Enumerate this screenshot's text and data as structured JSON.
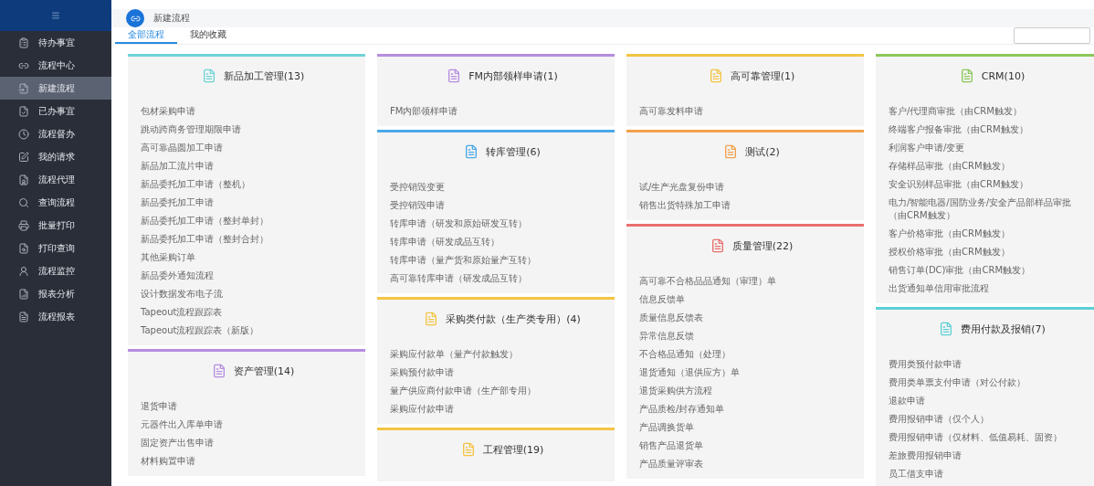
{
  "sidebar": {
    "items": [
      {
        "label": "待办事宜",
        "selected": false
      },
      {
        "label": "流程中心",
        "selected": false
      },
      {
        "label": "新建流程",
        "selected": true
      },
      {
        "label": "已办事宜",
        "selected": false
      },
      {
        "label": "流程督办",
        "selected": false
      },
      {
        "label": "我的请求",
        "selected": false
      },
      {
        "label": "流程代理",
        "selected": false
      },
      {
        "label": "查询流程",
        "selected": false
      },
      {
        "label": "批量打印",
        "selected": false
      },
      {
        "label": "打印查询",
        "selected": false
      },
      {
        "label": "流程监控",
        "selected": false
      },
      {
        "label": "报表分析",
        "selected": false
      },
      {
        "label": "流程报表",
        "selected": false
      }
    ]
  },
  "header": {
    "title": "新建流程"
  },
  "tabs": [
    {
      "label": "全部流程",
      "selected": true
    },
    {
      "label": "我的收藏",
      "selected": false
    }
  ],
  "columns": [
    [
      {
        "title": "新品加工管理(13)",
        "color": "#6fd3d6",
        "items": [
          "包材采购申请",
          "跳动跨商务管理期限申请",
          "高可靠晶圆加工申请",
          "新品加工流片申请",
          "新品委托加工申请（整机）",
          "新品委托加工申请",
          "新品委托加工申请（整封单封）",
          "新品委托加工申请（整封合封）",
          "其他采购订单",
          "新品委外通知流程",
          "设计数据发布电子流",
          "Tapeout流程跟踪表",
          "Tapeout流程跟踪表（新版）"
        ]
      },
      {
        "title": "资产管理(14)",
        "color": "#b68de0",
        "items": [
          "退货申请",
          "元器件出入库单申请",
          "固定资产出售申请",
          "材料购置申请"
        ]
      }
    ],
    [
      {
        "title": "FM内部领样申请(1)",
        "color": "#b68de0",
        "items": [
          "FM内部领样申请"
        ]
      },
      {
        "title": "转库管理(6)",
        "color": "#4aa8e8",
        "items": [
          "受控销毁变更",
          "受控销毁申请",
          "转库申请（研发和原始研发互转）",
          "转库申请（研发成品互转）",
          "转库申请（量产货和原始量产互转）",
          "高可靠转库申请（研发成品互转）"
        ]
      },
      {
        "title": "采购类付款（生产类专用）(4)",
        "color": "#f4c444",
        "items": [
          "采购应付款单（量产付款触发）",
          "采购预付款申请",
          "量产供应商付款申请（生产部专用）",
          "采购应付款申请"
        ]
      },
      {
        "title": "工程管理(19)",
        "color": "#f4c444"
      }
    ],
    [
      {
        "title": "高可靠管理(1)",
        "color": "#f4c444",
        "items": [
          "高可靠发料申请"
        ]
      },
      {
        "title": "测试(2)",
        "color": "#f3a04a",
        "items": [
          "试/生产光盘复份申请",
          "销售出货特殊加工申请"
        ]
      },
      {
        "title": "质量管理(22)",
        "color": "#e8706e",
        "items": [
          "高可靠不合格品品通知（审理）单",
          "信息反馈单",
          "质量信息反馈表",
          "异常信息反馈",
          "不合格品通知（处理）",
          "退货通知（退供应方）单",
          "退货采购供方流程",
          "产品质检/封存通知单",
          "产品调换货单",
          "销售产品退货单",
          "产品质量评审表"
        ]
      }
    ],
    [
      {
        "title": "CRM(10)",
        "color": "#8cc85a",
        "items": [
          "客户/代理商审批（由CRM触发）",
          "终端客户报备审批（由CRM触发）",
          "利润客户申请/变更",
          "存储样品审批（由CRM触发）",
          "安全识别样品审批（由CRM触发）",
          "电力/智能电器/国防业务/安全产品部样品审批（由CRM触发）",
          "客户价格审批（由CRM触发）",
          "授权价格审批（由CRM触发）",
          "销售订单(DC)审批（由CRM触发）",
          "出货通知单信用审批流程"
        ]
      },
      {
        "title": "费用付款及报销(7)",
        "color": "#5ccfd4",
        "items": [
          "费用类预付款申请",
          "费用类单票支付申请（对公付款）",
          "退款申请",
          "费用报销申请（仅个人）",
          "费用报销申请（仅材料、低值易耗、固资）",
          "差旅费用报销申请",
          "员工借支申请"
        ]
      }
    ]
  ]
}
